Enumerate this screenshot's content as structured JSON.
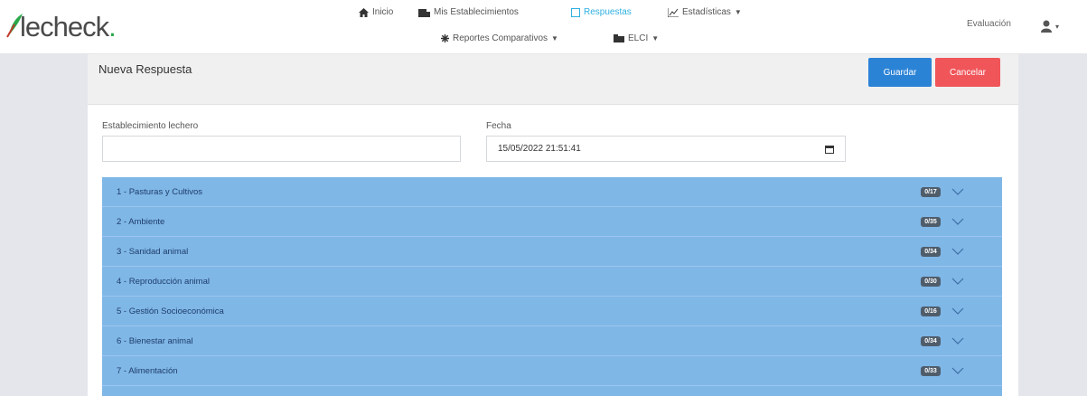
{
  "brand": {
    "name_main": "lecheck",
    "name_accent": "."
  },
  "nav": {
    "items": [
      {
        "icon": "home-icon",
        "label": "Inicio"
      },
      {
        "icon": "farm-icon",
        "label": "Mis Establecimientos"
      },
      {
        "icon": "checkbox-icon",
        "label": "Respuestas",
        "active": true
      },
      {
        "icon": "stats-icon",
        "label": "Estadísticas",
        "dropdown": true
      },
      {
        "icon": "asterisk-icon",
        "label": "Reportes Comparativos",
        "dropdown": true
      },
      {
        "icon": "elci-icon",
        "label": "ELCI",
        "dropdown": true
      }
    ],
    "right_label": "Evaluación"
  },
  "page": {
    "title": "Nueva Respuesta",
    "save_label": "Guardar",
    "cancel_label": "Cancelar"
  },
  "form": {
    "establishment_label": "Establecimiento lechero",
    "establishment_value": "",
    "date_label": "Fecha",
    "date_value": "15/05/2022 21:51:41"
  },
  "sections": [
    {
      "label": "1 - Pasturas y Cultivos",
      "badge": "0/17"
    },
    {
      "label": "2 - Ambiente",
      "badge": "0/35"
    },
    {
      "label": "3 - Sanidad animal",
      "badge": "0/34"
    },
    {
      "label": "4 - Reproducción animal",
      "badge": "0/30"
    },
    {
      "label": "5 - Gestión Socioeconómica",
      "badge": "0/16"
    },
    {
      "label": "6 - Bienestar animal",
      "badge": "0/34"
    },
    {
      "label": "7 - Alimentación",
      "badge": "0/33"
    }
  ],
  "colors": {
    "accent": "#2fb0e0",
    "primary_button": "#2b83d6",
    "danger_button": "#f0555a",
    "section_bg": "#7fb7e7",
    "badge_bg": "#4f5d6b"
  }
}
